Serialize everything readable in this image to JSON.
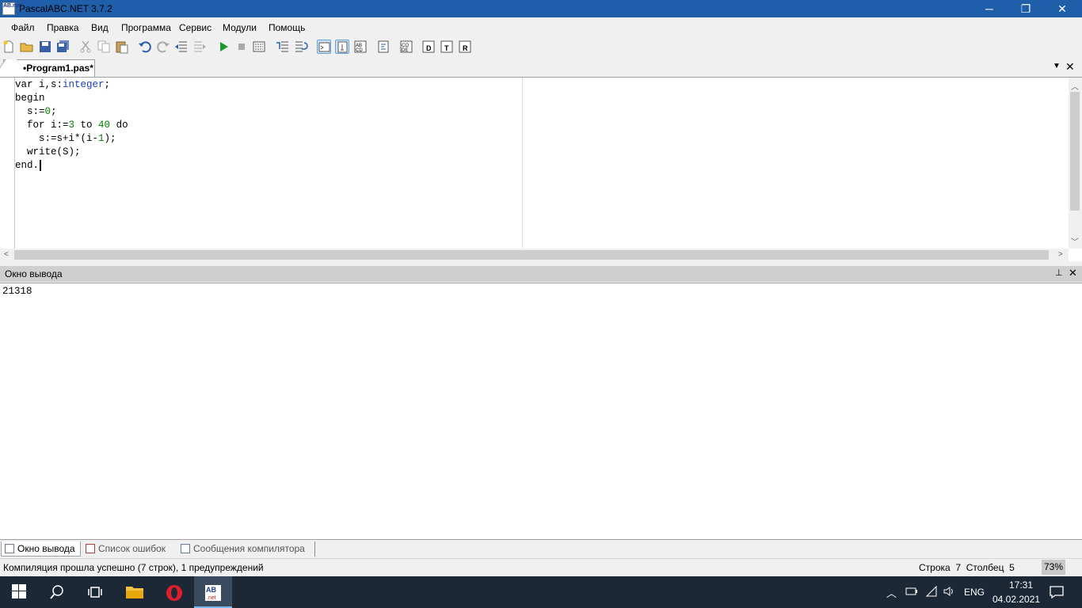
{
  "window": {
    "title": "PascalABC.NET 3.7.2",
    "icon_text": "AB.net"
  },
  "title_buttons": {
    "minimize": "─",
    "maximize": "❐",
    "close": "✕"
  },
  "menu": [
    "Файл",
    "Правка",
    "Вид",
    "Программа",
    "Сервис",
    "Модули",
    "Помощь"
  ],
  "toolbar": {
    "icons": [
      "new-file-icon",
      "open-folder-icon",
      "save-icon",
      "save-all-icon",
      "cut-icon",
      "copy-icon",
      "paste-icon",
      "undo-icon",
      "redo-icon",
      "unindent-icon",
      "indent-icon",
      "run-icon",
      "stop-icon",
      "compile-icon",
      "step-into-icon",
      "step-over-icon",
      "view-mode-1-icon",
      "view-mode-2-icon",
      "view-mode-3-icon",
      "format-icon",
      "code-icon",
      "debug-d-icon",
      "debug-t-icon",
      "debug-r-icon"
    ]
  },
  "editor": {
    "tab_label": "•Program1.pas*",
    "lines": [
      [
        [
          "var i,s:",
          "kw"
        ],
        [
          "integer",
          "ty"
        ],
        [
          ";",
          "kw"
        ]
      ],
      [
        [
          "begin",
          "kw"
        ]
      ],
      [
        [
          "  s:=",
          "kw"
        ],
        [
          "0",
          "num"
        ],
        [
          ";",
          "kw"
        ]
      ],
      [
        [
          "  for i:=",
          "kw"
        ],
        [
          "3",
          "num"
        ],
        [
          " to ",
          "kw"
        ],
        [
          "40",
          "num"
        ],
        [
          " do",
          "kw"
        ]
      ],
      [
        [
          "    s:=s+i*(i-",
          "kw"
        ],
        [
          "1",
          "num"
        ],
        [
          ");",
          "kw"
        ]
      ],
      [
        [
          "  write(S);",
          "kw"
        ]
      ],
      [
        [
          "end.",
          "kw"
        ]
      ]
    ]
  },
  "output": {
    "title": "Окно вывода",
    "text": "21318",
    "pin": "📌",
    "close": "✕"
  },
  "bottom_tabs": [
    {
      "label": "Окно вывода",
      "active": true
    },
    {
      "label": "Список ошибок",
      "active": false
    },
    {
      "label": "Сообщения компилятора",
      "active": false
    }
  ],
  "status": {
    "message": "Компиляция прошла успешно (7 строк), 1 предупреждений",
    "row_label": "Строка",
    "row": "7",
    "col_label": "Столбец",
    "col": "5",
    "zoom": "73%"
  },
  "taskbar": {
    "lang": "ENG",
    "time": "17:31",
    "date": "04.02.2021"
  },
  "colors": {
    "titlebar": "#1f5ea8",
    "taskbar": "#1c2836",
    "keyword_type": "#1e40b0",
    "number": "#008000"
  }
}
